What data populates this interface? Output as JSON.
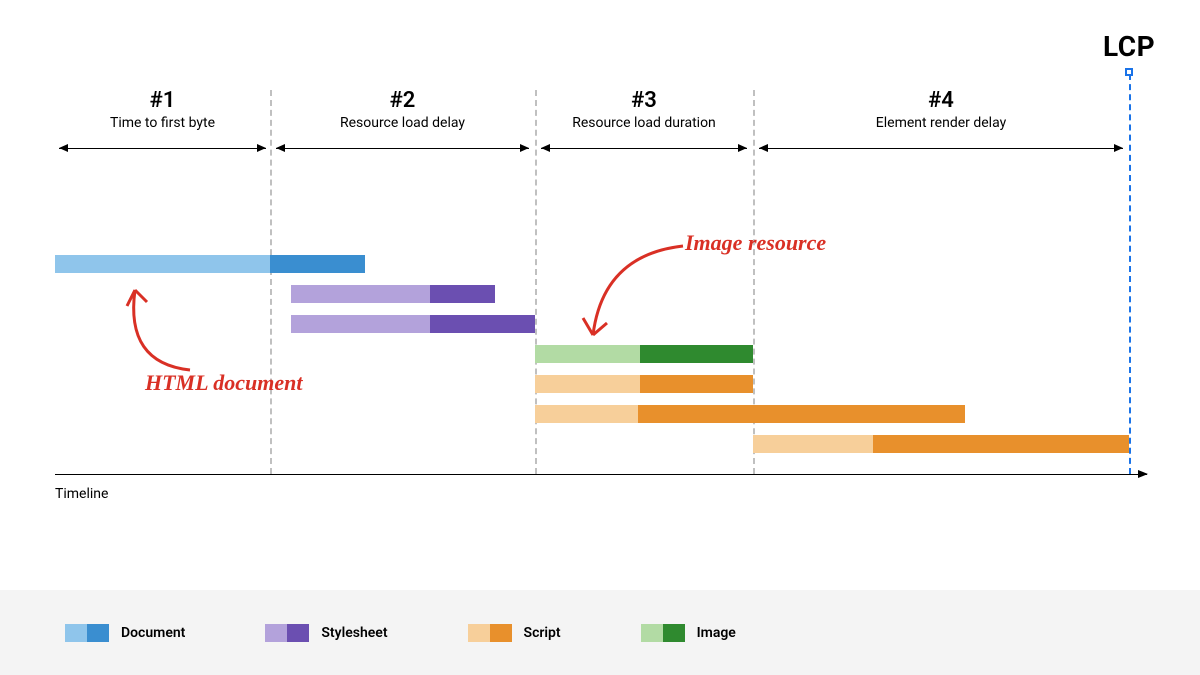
{
  "lcp_label": "LCP",
  "phases": [
    {
      "num": "#1",
      "desc": "Time to first byte"
    },
    {
      "num": "#2",
      "desc": "Resource load delay"
    },
    {
      "num": "#3",
      "desc": "Resource load duration"
    },
    {
      "num": "#4",
      "desc": "Element render delay"
    }
  ],
  "annotations": {
    "html_document": "HTML document",
    "image_resource": "Image resource"
  },
  "axis_label": "Timeline",
  "legend": {
    "document": "Document",
    "stylesheet": "Stylesheet",
    "script": "Script",
    "image": "Image"
  },
  "chart_data": {
    "type": "gantt",
    "x_unit": "relative",
    "x_range": [
      0,
      100
    ],
    "lcp_x": 100,
    "phase_boundaries": [
      0,
      20,
      45,
      66,
      100
    ],
    "bars": [
      {
        "resource": "Document",
        "track": 0,
        "start": 0,
        "split": 20,
        "end": 29
      },
      {
        "resource": "Stylesheet",
        "track": 1,
        "start": 22,
        "split": 35,
        "end": 41
      },
      {
        "resource": "Stylesheet",
        "track": 2,
        "start": 22,
        "split": 35,
        "end": 45
      },
      {
        "resource": "Image",
        "track": 3,
        "start": 45,
        "split": 55,
        "end": 66
      },
      {
        "resource": "Script",
        "track": 4,
        "start": 45,
        "split": 55,
        "end": 66
      },
      {
        "resource": "Script",
        "track": 5,
        "start": 45,
        "split": 55,
        "end": 85
      },
      {
        "resource": "Script",
        "track": 6,
        "start": 66,
        "split": 77,
        "end": 100
      }
    ],
    "legend_order": [
      "Document",
      "Stylesheet",
      "Script",
      "Image"
    ]
  }
}
